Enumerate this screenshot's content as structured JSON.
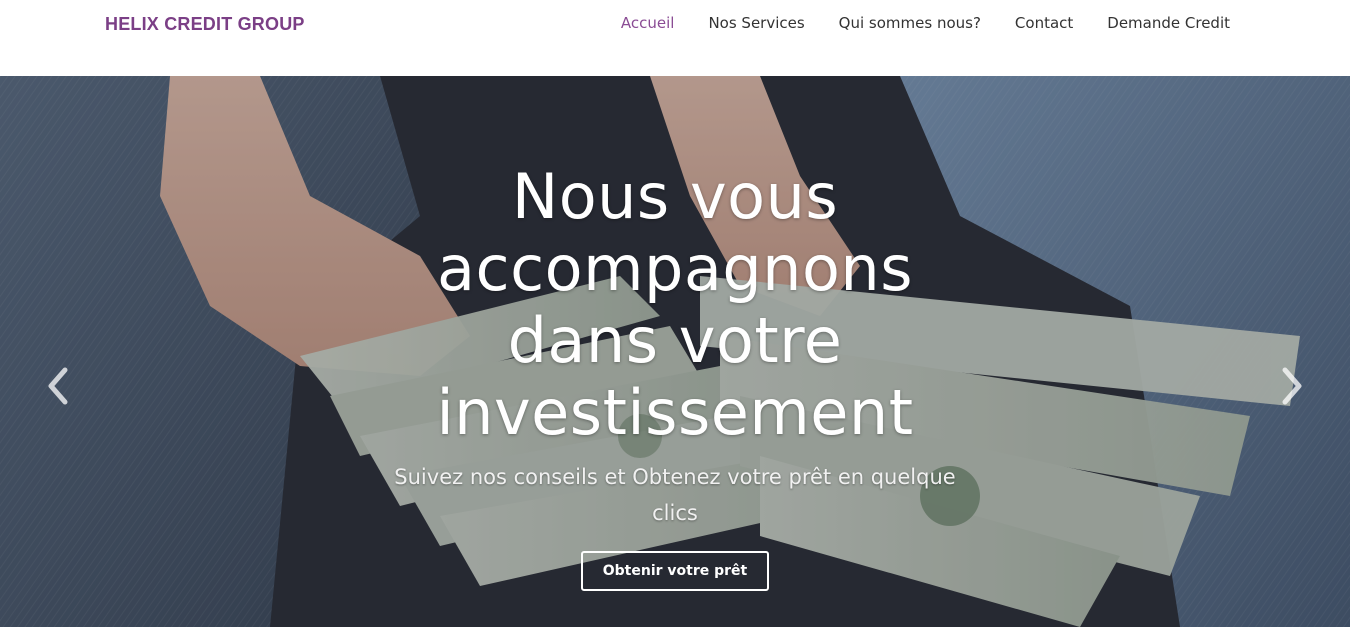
{
  "brand": "HELIX CREDIT GROUP",
  "nav": [
    {
      "label": "Accueil",
      "active": true
    },
    {
      "label": "Nos Services"
    },
    {
      "label": "Qui sommes nous?"
    },
    {
      "label": "Contact"
    },
    {
      "label": "Demande Credit"
    }
  ],
  "hero": {
    "headline": "Nous vous accompagnons dans votre investissement",
    "subtitle": "Suivez nos conseils et Obtenez votre prêt en quelque clics",
    "cta": "Obtenir votre prêt",
    "prev_icon": "chevron-left-icon",
    "next_icon": "chevron-right-icon"
  },
  "colors": {
    "brand": "#7b3f86",
    "nav_active": "#8a4c94",
    "nav_text": "#333333",
    "hero_text": "#ffffff"
  }
}
